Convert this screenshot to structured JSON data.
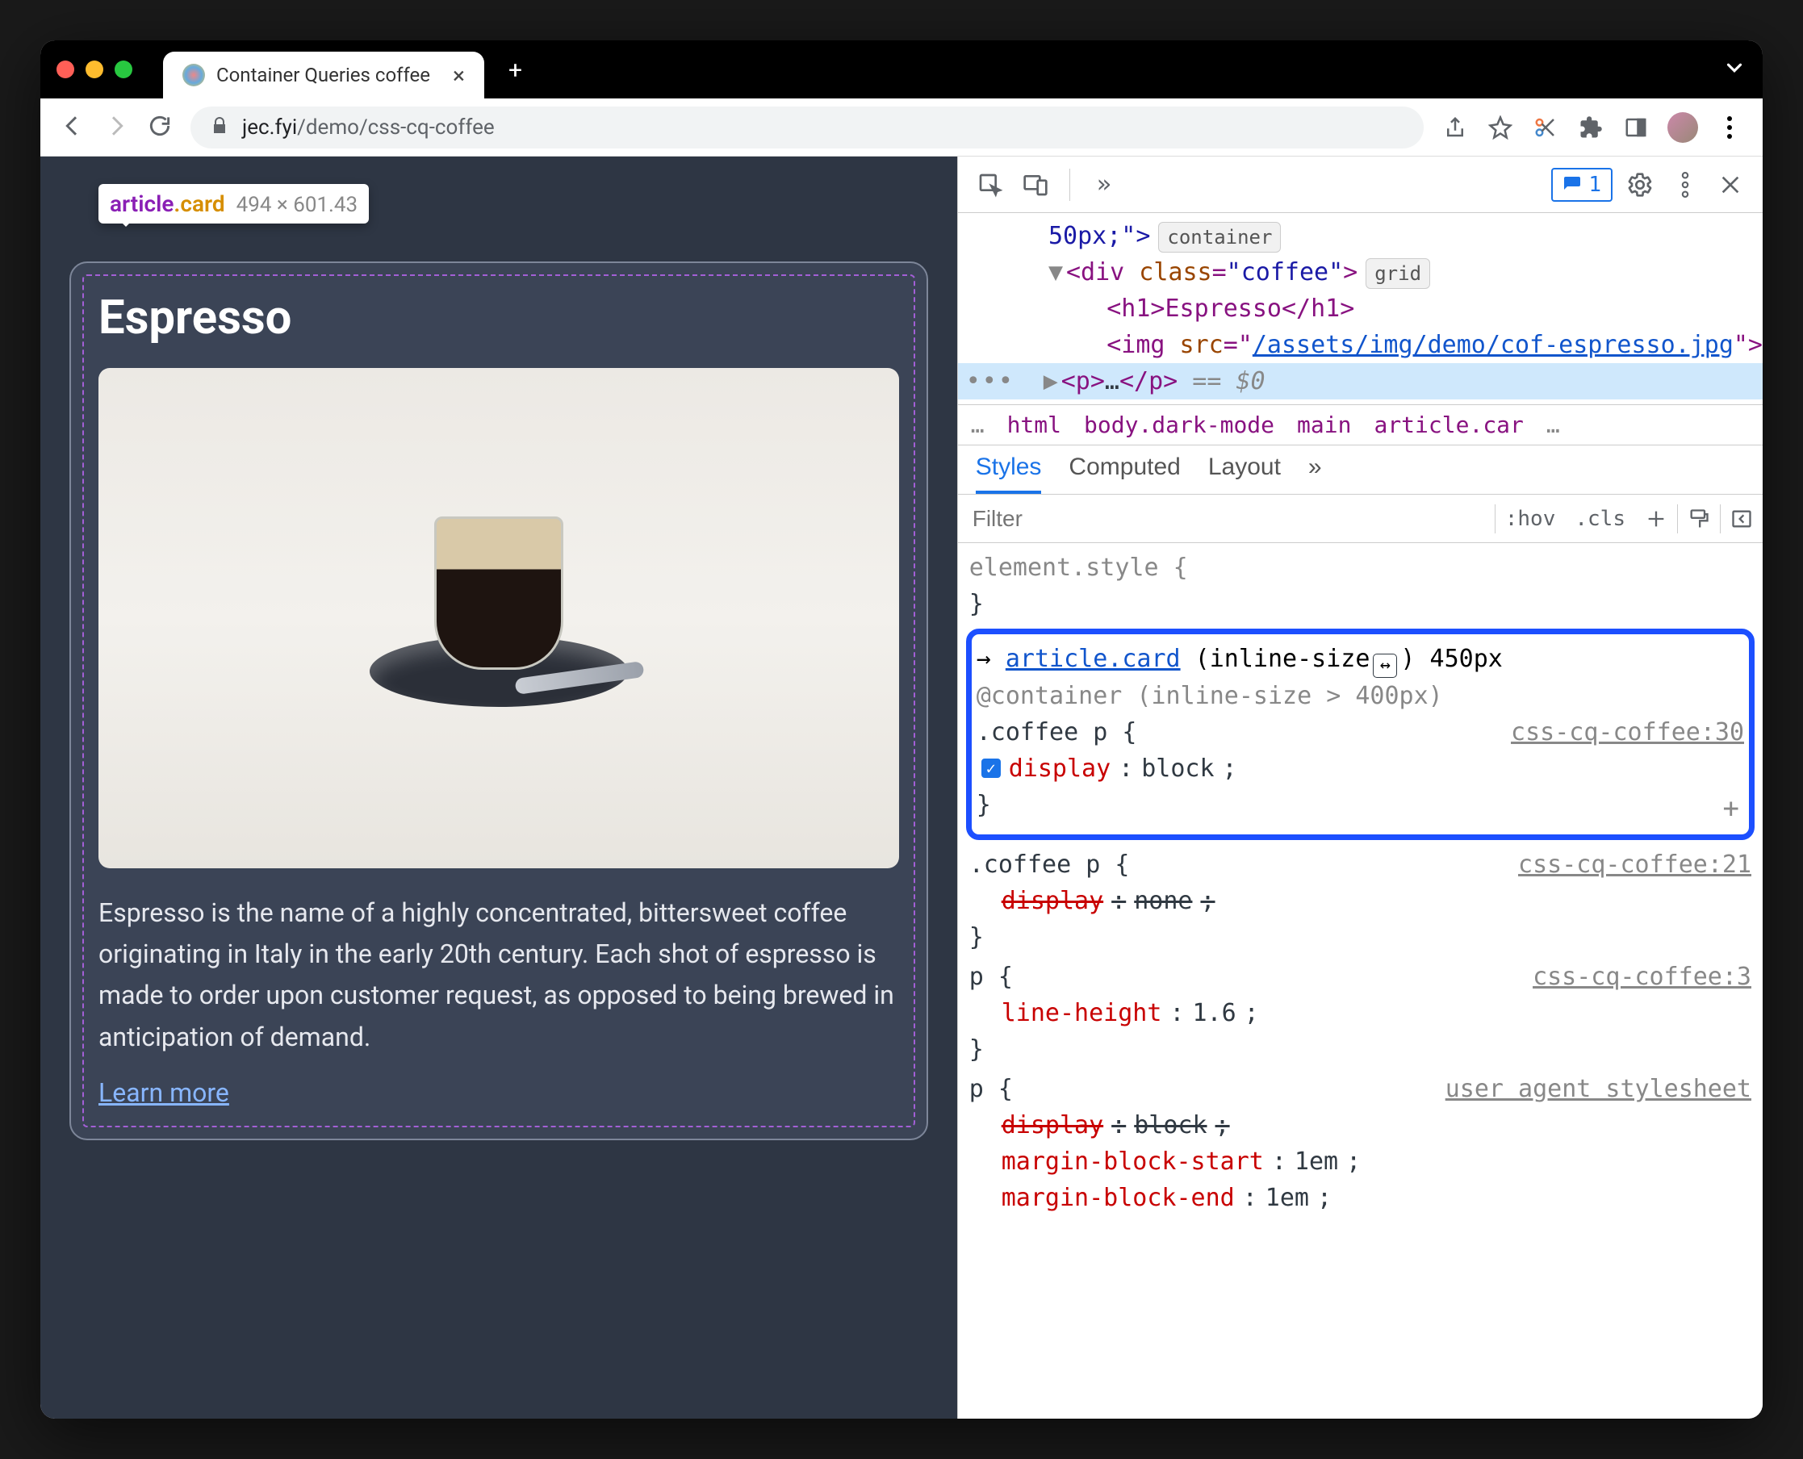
{
  "browser": {
    "tab_title": "Container Queries coffee",
    "url_host": "jec.fyi",
    "url_path": "/demo/css-cq-coffee"
  },
  "inspect_tooltip": {
    "selector_tag": "article",
    "selector_class": ".card",
    "dimensions": "494 × 601.43"
  },
  "page": {
    "heading": "Espresso",
    "paragraph": "Espresso is the name of a highly concentrated, bittersweet coffee originating in Italy in the early 20th century. Each shot of espresso is made to order upon customer request, as opposed to being brewed in anticipation of demand.",
    "link_text": "Learn more"
  },
  "devtools": {
    "issues_count": "1",
    "dom": {
      "line1_fragment": "50px;\">",
      "line1_badge": "container",
      "line2_tag_open": "<div ",
      "line2_attr_name": "class",
      "line2_attr_val": "\"coffee\"",
      "line2_close": ">",
      "line2_badge": "grid",
      "line3": "<h1>Espresso</h1>",
      "line4_pre": "<img ",
      "line4_attr": "src",
      "line4_eq": "=\"",
      "line4_link": "/assets/img/demo/cof-espresso.jpg",
      "line4_post": "\">",
      "line5_sel_open": "<p>",
      "line5_sel_ell": "…",
      "line5_sel_close": "</p>",
      "line5_sel_eq": " == $0"
    },
    "crumbs": [
      "…",
      "html",
      "body.dark-mode",
      "main",
      "article.car",
      "…"
    ],
    "style_tabs": [
      "Styles",
      "Computed",
      "Layout",
      "»"
    ],
    "filter_placeholder": "Filter",
    "filter_hov": ":hov",
    "filter_cls": ".cls",
    "rules": {
      "element_style": "element.style {",
      "hl_container_sel": "article.card",
      "hl_inline_label_pre": " (inline-size",
      "hl_inline_label_post": ") 450px",
      "hl_at": "@container (inline-size > 400px)",
      "hl_sel": ".coffee p {",
      "hl_src": "css-cq-coffee:30",
      "hl_prop": "display",
      "hl_val": "block",
      "r2_sel": ".coffee p {",
      "r2_src": "css-cq-coffee:21",
      "r2_prop": "display",
      "r2_val": "none",
      "r3_sel": "p {",
      "r3_src": "css-cq-coffee:3",
      "r3_prop": "line-height",
      "r3_val": "1.6",
      "r4_sel": "p {",
      "r4_src": "user agent stylesheet",
      "r4_p1": "display",
      "r4_v1": "block",
      "r4_p2": "margin-block-start",
      "r4_v2": "1em",
      "r4_p3": "margin-block-end",
      "r4_v3": "1em"
    }
  }
}
